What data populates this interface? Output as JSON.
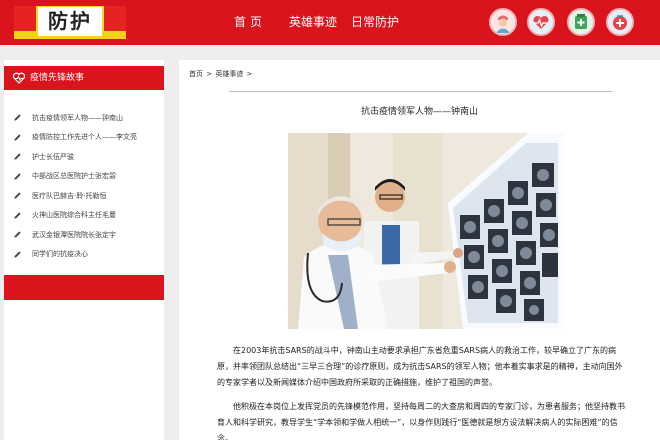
{
  "header": {
    "logo_text": "防护",
    "nav": {
      "home": "首页",
      "hero": "英雄事迹",
      "daily": "日常防护"
    },
    "icons": [
      "nurse-avatar-icon",
      "heart-monitor-icon",
      "medicine-icon",
      "first-aid-icon"
    ],
    "accent_color": "#d9141c"
  },
  "sidebar": {
    "title": "疫情先锋故事",
    "items": [
      {
        "label": "抗击疫情领军人物——钟南山"
      },
      {
        "label": "疫情防控工作先进个人——李文亮"
      },
      {
        "label": "护士长伍严骏"
      },
      {
        "label": "中部战区总医院护士张宏碧"
      },
      {
        "label": "医疗队巴赫吉·聆·托勒恒"
      },
      {
        "label": "火神山医院综合科主任毛蔓"
      },
      {
        "label": "武汉金银潭医院院长张定宇"
      },
      {
        "label": "同学们的抗疫决心"
      }
    ]
  },
  "main": {
    "breadcrumb": {
      "home": "首页",
      "sep": " > ",
      "section": "英雄事迹",
      "tail": " >"
    },
    "title": "抗击疫情领军人物——钟南山",
    "paragraphs": [
      "在2003年抗击SARS的战斗中，钟南山主动要求承担广东省危重SARS病人的救治工作，较早确立了广东的病原，并率领团队总结出“三早三合理”的诊疗原则，成为抗击SARS的领军人物；他本着实事求是的精神，主动向国外的专家学者以及新闻媒体介绍中国政府所采取的正确措施，维护了祖国的声誉。",
      "他积极在本岗位上发挥党员的先锋模范作用，坚持每周二的大查房和周四的专家门诊，为患者服务；他坚持教书育人和科学研究，教导学生“学本领和学做人相统一”，以身作则践行“医德就是想方设法解决病人的实际困难”的信念。"
    ]
  }
}
